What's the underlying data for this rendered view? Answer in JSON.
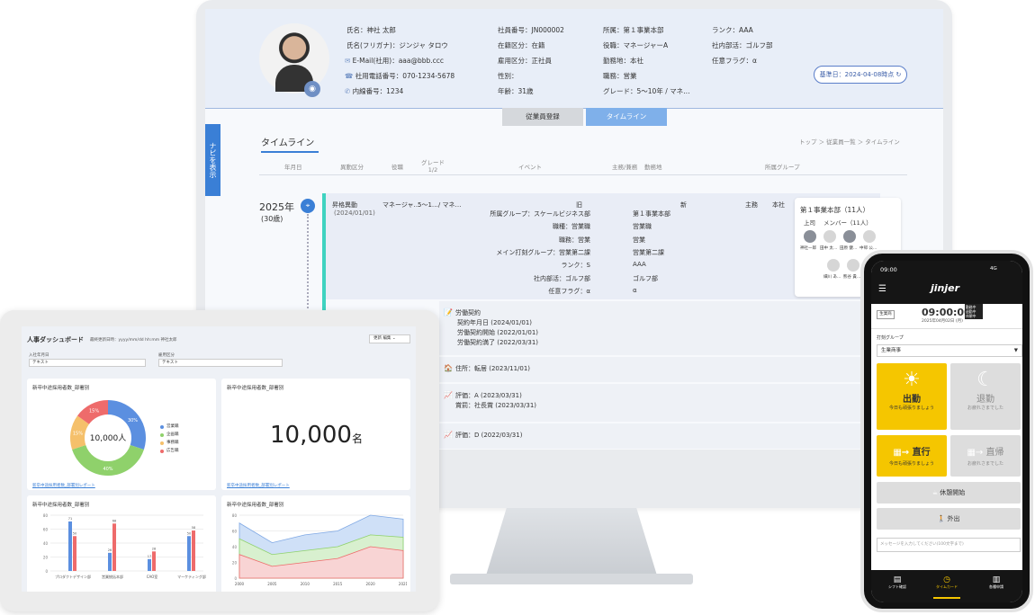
{
  "profile": {
    "name": "氏名：神社 太郎",
    "kana": "氏名(フリガナ)：ジンジャ タロウ",
    "email": "E-Mail(社用)：aaa@bbb.ccc",
    "phone": "社用電話番号：070-1234-5678",
    "ext": "内線番号：1234",
    "emp_no": "社員番号：JN000002",
    "status": "在籍区分：在籍",
    "employment": "雇用区分：正社員",
    "gender": "性別：",
    "age": "年齢：31歳",
    "dept": "所属：第１事業本部",
    "position": "役職：マネージャーA",
    "location": "勤務地：本社",
    "job": "職務：営業",
    "grade": "グレード：5〜10年 / マネ…",
    "rank": "ランク：AAA",
    "club": "社内部活：ゴルフ部",
    "flag": "任意フラグ：α",
    "base_date": "基準日：2024-04-08時点 ↻"
  },
  "tabs": [
    "従業員登録",
    "タイムライン"
  ],
  "navi": "ナビを表示",
  "timeline": {
    "title": "タイムライン",
    "breadcrumb": "トップ ＞ 従業員一覧 ＞ タイムライン",
    "headers": [
      "年月日",
      "異動区分",
      "役職",
      "グレード\n1/2",
      "イベント",
      "主務/兼務",
      "勤務地",
      "所属グループ"
    ],
    "year": "2025年",
    "age": "(30歳)",
    "move": {
      "type": "昇格異動",
      "date": "(2024/01/01)",
      "role": "マネージャ…",
      "grade": "5〜1…/ マネ…",
      "main": "主務",
      "loc": "本社",
      "old_h": "旧",
      "new_h": "新",
      "rows": [
        [
          "所属グループ：スケールビジネス部",
          "第１事業本部"
        ],
        [
          "職種：営業職",
          "営業職"
        ],
        [
          "職務：営業",
          "営業"
        ],
        [
          "メイン打刻グループ：営業第二課",
          "営業第二課"
        ],
        [
          "ランク：S",
          "AAA"
        ],
        [
          "社内部活：ゴルフ部",
          "ゴルフ部"
        ],
        [
          "任意フラグ：α",
          "α"
        ]
      ]
    },
    "group_card": {
      "title": "第１事業本部（11人）",
      "boss": "上司",
      "members": "メンバー（11人）",
      "names": [
        "神社一郎",
        "田中 太…",
        "田原 健…",
        "中邨 公…",
        "細川 あ…",
        "熊谷 貴…"
      ]
    },
    "events": [
      {
        "icon": "📝",
        "lines": [
          "労働契約",
          "契約年月日 (2024/01/01)",
          "労働契約開始 (2022/01/01)",
          "労働契約満了 (2022/03/31)"
        ]
      },
      {
        "icon": "🏠",
        "lines": [
          "住所：転居 (2023/11/01)"
        ]
      },
      {
        "icon": "📈",
        "lines": [
          "評価：A (2023/03/31)",
          "賞罰：社長賞 (2023/03/31)"
        ]
      },
      {
        "icon": "📈",
        "lines": [
          "評価：D (2022/03/31)"
        ]
      }
    ]
  },
  "dashboard": {
    "title": "人事ダッシュボード",
    "updated": "最終更新日時：yyyy/mm/dd hh:mm 神社太郎",
    "btn_update": "更新",
    "btn_edit": "編集 ⌄",
    "filter1_label": "入社年月日",
    "filter1": "テキスト",
    "filter2_label": "雇用区分",
    "filter2": "テキスト",
    "card_title": "新卒中途採用者数_部署別",
    "link": "新卒中途採用者数_部署別レポート",
    "donut_total": "10,000",
    "donut_unit": "人",
    "big_number": "10,000",
    "big_unit": "名",
    "legend": [
      "営業職",
      "企画職",
      "事務職",
      "広告職"
    ],
    "bar_categories": [
      "プロダクトデザイン部",
      "営業統括本部",
      "CAO室",
      "マーケティング部"
    ],
    "line_x": [
      "2000",
      "2005",
      "2010",
      "2015",
      "2020",
      "2021"
    ]
  },
  "chart_data": [
    {
      "type": "pie",
      "title": "新卒中途採用者数_部署別",
      "categories": [
        "営業職",
        "企画職",
        "事務職",
        "広告職"
      ],
      "values": [
        30,
        40,
        15,
        15
      ],
      "colors": [
        "#5b8fe0",
        "#8fd16b",
        "#f5c06b",
        "#ee6b6b"
      ]
    },
    {
      "type": "bar",
      "title": "新卒中途採用者数_部署別",
      "categories": [
        "プロダクトデザイン部",
        "営業統括本部",
        "CAO室",
        "マーケティング部"
      ],
      "series": [
        {
          "values": [
            71,
            26,
            17,
            50
          ]
        },
        {
          "values": [
            50,
            68,
            28,
            58
          ]
        }
      ],
      "ylim": [
        0,
        80
      ]
    },
    {
      "type": "area",
      "title": "新卒中途採用者数_部署別",
      "x": [
        "2000",
        "2005",
        "2010",
        "2015",
        "2020",
        "2021"
      ],
      "series": [
        {
          "values": [
            70,
            45,
            55,
            60,
            80,
            75
          ]
        },
        {
          "values": [
            50,
            30,
            35,
            40,
            55,
            52
          ]
        },
        {
          "values": [
            30,
            15,
            20,
            25,
            40,
            35
          ]
        }
      ],
      "ylim": [
        0,
        80
      ]
    }
  ],
  "phone": {
    "time": "09:00",
    "signal": "4G",
    "brand": "jinjer",
    "badge": "生業商",
    "clock": "09:00:00",
    "date": "2025年04月02日 (月)",
    "status": [
      "勤務中",
      "退勤中",
      "休憩中"
    ],
    "group_label": "打刻グループ",
    "group": "生業商事",
    "in_title": "出勤",
    "in_sub": "今日も頑張りましょう",
    "out_title": "退勤",
    "out_sub": "お疲れさまでした",
    "direct_title": "直行",
    "direct_sub": "今日も頑張りましょう",
    "return_title": "直帰",
    "return_sub": "お疲れさまでした",
    "break": "休憩開始",
    "away": "外出",
    "msg_ph": "メッセージを入力してください(100文字まで)",
    "nav": [
      "シフト確認",
      "タイムカード",
      "各種申請"
    ]
  }
}
